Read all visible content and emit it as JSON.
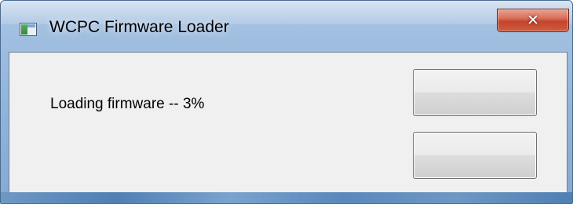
{
  "window": {
    "title": "WCPC Firmware Loader",
    "icon": "application-window-icon",
    "close_glyph": "✕"
  },
  "main": {
    "status_text": "Loading firmware -- 3%",
    "buttons": [
      {
        "label": ""
      },
      {
        "label": ""
      }
    ]
  },
  "colors": {
    "client_background": "#f0f0f0",
    "close_button_red": "#c4452c",
    "frame_blue": "#9bbbdf"
  }
}
